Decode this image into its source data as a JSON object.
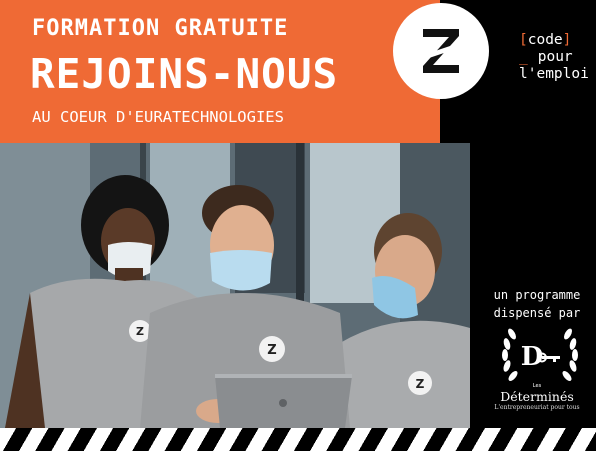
{
  "banner": {
    "line1": "FORMATION GRATUITE",
    "line2": "REJOINS-NOUS",
    "line3": "AU COEUR D'EURATECHNOLOGIES",
    "color": "#ef6a35"
  },
  "logo_z": {
    "letter": "Z",
    "icon": "z-circle-logo"
  },
  "code_pour_emploi": {
    "open_bracket": "[",
    "word_code": "code",
    "close_bracket": "]",
    "underscore": "_",
    "word_pour": "pour",
    "line3": "l'emploi"
  },
  "sidebar": {
    "line1": "un programme",
    "line2": "dispensé par"
  },
  "determines": {
    "letter": "D",
    "small_text": "Les",
    "name": "Déterminés",
    "tagline": "L'entrepreneuriat pour tous"
  },
  "photo": {
    "alt": "Trois apprenants masqués devant un ordinateur portable",
    "shirt_badge": "Z"
  }
}
